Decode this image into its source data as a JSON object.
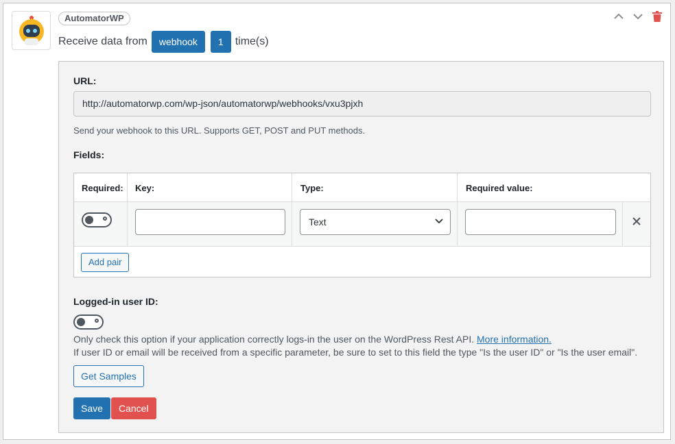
{
  "header": {
    "integration_badge": "AutomatorWP",
    "sentence_prefix": "Receive data from",
    "trigger_pill": "webhook",
    "times_pill": "1",
    "sentence_suffix": "time(s)"
  },
  "icons": {
    "move_up": "chevron-up-icon",
    "move_down": "chevron-down-icon",
    "delete": "trash-icon",
    "logo": "robot-logo-icon",
    "remove_row": "close-icon",
    "select_arrow": "chevron-down-icon"
  },
  "colors": {
    "primary": "#2271b1",
    "danger": "#e1524f",
    "logo_yellow": "#f9b723"
  },
  "url_section": {
    "label": "URL:",
    "value": "http://automatorwp.com/wp-json/automatorwp/webhooks/vxu3pjxh",
    "description": "Send your webhook to this URL. Supports GET, POST and PUT methods."
  },
  "fields_section": {
    "label": "Fields:",
    "columns": [
      "Required:",
      "Key:",
      "Type:",
      "Required value:"
    ],
    "rows": [
      {
        "required": false,
        "key": "",
        "type": "Text",
        "required_value": ""
      }
    ],
    "add_pair_label": "Add pair"
  },
  "logged_in_section": {
    "label": "Logged-in user ID:",
    "enabled": false,
    "description_line1": "Only check this option if your application correctly logs-in the user on the WordPress Rest API.",
    "more_info_link": "More information.",
    "description_line2": "If user ID or email will be received from a specific parameter, be sure to set to this field the type \"Is the user ID\" or \"Is the user email\"."
  },
  "actions": {
    "get_samples": "Get Samples",
    "save": "Save",
    "cancel": "Cancel"
  }
}
